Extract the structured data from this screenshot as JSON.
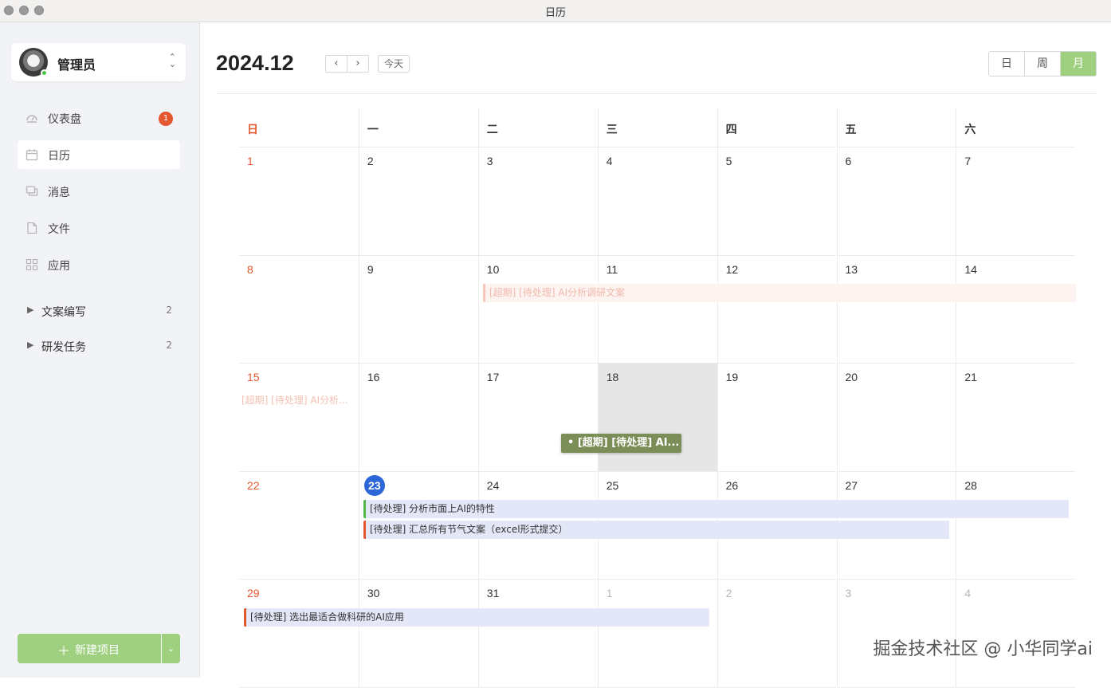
{
  "window": {
    "title": "日历"
  },
  "user": {
    "name": "管理员",
    "toggle_icon": "chevron-updown-icon"
  },
  "nav": [
    {
      "label": "仪表盘",
      "icon": "dashboard-icon",
      "badge": "1"
    },
    {
      "label": "日历",
      "icon": "calendar-icon",
      "active": true
    },
    {
      "label": "消息",
      "icon": "message-icon"
    },
    {
      "label": "文件",
      "icon": "file-icon"
    },
    {
      "label": "应用",
      "icon": "apps-icon"
    }
  ],
  "groups": [
    {
      "label": "文案编写",
      "count": "2"
    },
    {
      "label": "研发任务",
      "count": "2"
    }
  ],
  "new_project": {
    "label": "新建项目",
    "plus": "＋",
    "arrow": "⌄"
  },
  "header": {
    "month": "2024.12",
    "prev": "‹",
    "next": "›",
    "today": "今天",
    "views": [
      "日",
      "周",
      "月"
    ],
    "active_view": "月"
  },
  "weekdays": [
    "日",
    "一",
    "二",
    "三",
    "四",
    "五",
    "六"
  ],
  "weeks": [
    [
      "1",
      "2",
      "3",
      "4",
      "5",
      "6",
      "7"
    ],
    [
      "8",
      "9",
      "10",
      "11",
      "12",
      "13",
      "14"
    ],
    [
      "15",
      "16",
      "17",
      "18",
      "19",
      "20",
      "21"
    ],
    [
      "22",
      "23",
      "24",
      "25",
      "26",
      "27",
      "28"
    ],
    [
      "29",
      "30",
      "31",
      "1",
      "2",
      "3",
      "4"
    ]
  ],
  "today": "23",
  "events": {
    "faded_week2": "[超期] [待处理] AI分析调研文案",
    "faded_week3": "[超期] [待处理] AI分析...",
    "drag_ghost": "[超期] [待处理] AI...",
    "week4_a": "[待处理] 分析市面上AI的特性",
    "week4_b": "[待处理] 汇总所有节气文案（excel形式提交）",
    "week5_a": "[待处理] 选出最适合做科研的AI应用"
  },
  "watermark": "掘金技术社区 @ 小华同学ai",
  "colors": {
    "accent": "#9ed07f",
    "sunday": "#e4572e",
    "today": "#2c66d8",
    "event_bg": "#e3e7f8"
  }
}
